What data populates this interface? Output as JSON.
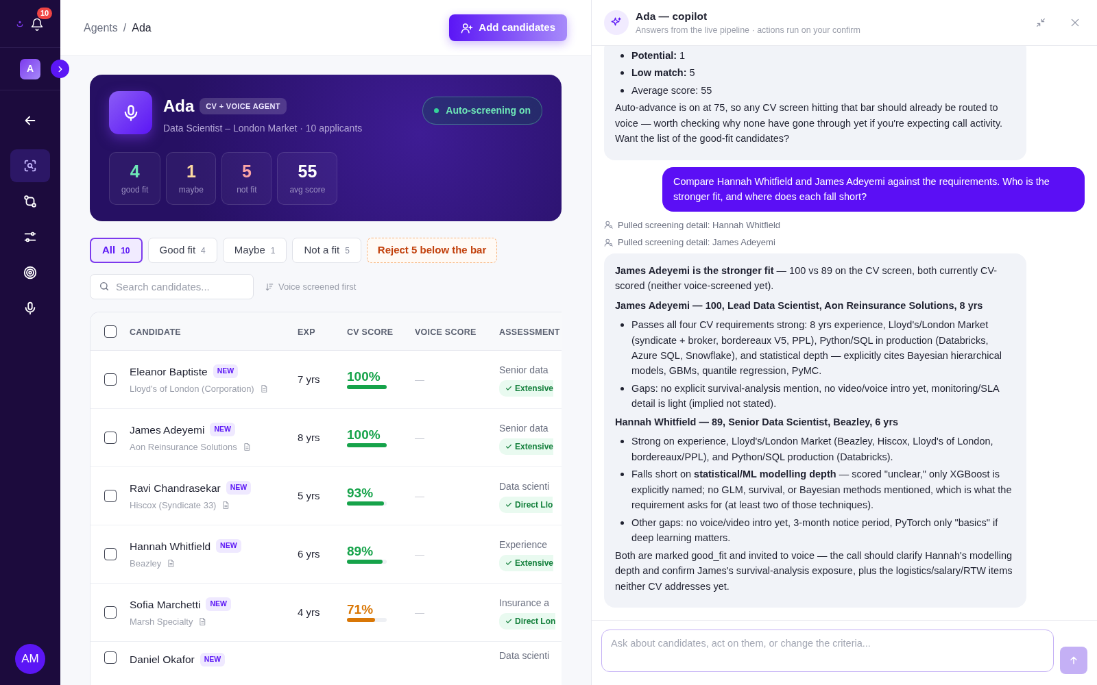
{
  "sidebar": {
    "notifications": "10",
    "workspace": "A",
    "nav": [
      {
        "kind": "back",
        "selected": false
      },
      {
        "kind": "scan",
        "selected": true
      },
      {
        "kind": "compare",
        "selected": false
      },
      {
        "kind": "sliders",
        "selected": false
      },
      {
        "kind": "target",
        "selected": false
      },
      {
        "kind": "mic",
        "selected": false
      }
    ],
    "user": "AM"
  },
  "header": {
    "breadcrumb": [
      "Agents",
      "Ada"
    ],
    "separator": "/",
    "action": "Add candidates"
  },
  "agent": {
    "name": "Ada",
    "badge": "CV + VOICE AGENT",
    "subtitle": "Data Scientist – London Market · 10 applicants",
    "auto_screening": {
      "label": "Auto-screening on",
      "on": true
    },
    "stats": [
      {
        "value": "4",
        "label": "good fit",
        "color": "#6ee7b7"
      },
      {
        "value": "1",
        "label": "maybe",
        "color": "#fcd9a0"
      },
      {
        "value": "5",
        "label": "not fit",
        "color": "#fca5a5"
      },
      {
        "value": "55",
        "label": "avg score",
        "color": "#ffffff"
      }
    ]
  },
  "filters": [
    {
      "label": "All",
      "count": "10",
      "selected": true
    },
    {
      "label": "Good fit",
      "count": "4",
      "selected": false
    },
    {
      "label": "Maybe",
      "count": "1",
      "selected": false
    },
    {
      "label": "Not a fit",
      "count": "5",
      "selected": false
    }
  ],
  "reject_action": "Reject 5 below the bar",
  "search": {
    "placeholder": "Search candidates..."
  },
  "sort": "Voice screened first",
  "table": {
    "columns": [
      "CANDIDATE",
      "EXP",
      "CV SCORE",
      "VOICE SCORE",
      "ASSESSMENT"
    ],
    "select_all": false,
    "rows": [
      {
        "name": "Eleanor Baptiste",
        "new": true,
        "badge": "NEW",
        "company": "Lloyd's of London (Corporation)",
        "exp": "7 yrs",
        "cv_score": "100%",
        "level": 1.0,
        "color": "#16a34a",
        "voice_score": "—",
        "assessment": "Senior data",
        "tag": "Extensive",
        "checked": false
      },
      {
        "name": "James Adeyemi",
        "new": true,
        "badge": "NEW",
        "company": "Aon Reinsurance Solutions",
        "exp": "8 yrs",
        "cv_score": "100%",
        "level": 1.0,
        "color": "#16a34a",
        "voice_score": "—",
        "assessment": "Senior data",
        "tag": "Extensive",
        "checked": false
      },
      {
        "name": "Ravi Chandrasekar",
        "new": true,
        "badge": "NEW",
        "company": "Hiscox (Syndicate 33)",
        "exp": "5 yrs",
        "cv_score": "93%",
        "level": 0.93,
        "color": "#16a34a",
        "voice_score": "—",
        "assessment": "Data scienti",
        "tag": "Direct Llo",
        "checked": false
      },
      {
        "name": "Hannah Whitfield",
        "new": true,
        "badge": "NEW",
        "company": "Beazley",
        "exp": "6 yrs",
        "cv_score": "89%",
        "level": 0.89,
        "color": "#16a34a",
        "voice_score": "—",
        "assessment": "Experience",
        "tag": "Extensive",
        "checked": false
      },
      {
        "name": "Sofia Marchetti",
        "new": true,
        "badge": "NEW",
        "company": "Marsh Specialty",
        "exp": "4 yrs",
        "cv_score": "71%",
        "level": 0.71,
        "color": "#d97706",
        "voice_score": "—",
        "assessment": "Insurance a",
        "tag": "Direct Lon",
        "checked": false
      },
      {
        "name": "Daniel Okafor",
        "new": true,
        "badge": "NEW",
        "assessment": "Data scienti",
        "checked": false
      }
    ]
  },
  "copilot": {
    "title": "Ada — copilot",
    "subtitle": "Answers from the live pipeline · actions run on your confirm",
    "messages": [
      {
        "kind": "assistant",
        "blocks": [
          {
            "kind": "list",
            "items": [
              "**Potential:** 1",
              "**Low match:** 5",
              "Average score: 55"
            ]
          },
          {
            "kind": "p",
            "text": "Auto-advance is on at 75, so any CV screen hitting that bar should already be routed to voice — worth checking why none have gone through yet if you're expecting call activity. Want the list of the good-fit candidates?"
          }
        ]
      },
      {
        "kind": "user",
        "text": "Compare Hannah Whitfield and James Adeyemi against the requirements. Who is the stronger fit, and where does each fall short?"
      },
      {
        "kind": "tool",
        "text": "Pulled screening detail: Hannah Whitfield"
      },
      {
        "kind": "tool",
        "text": "Pulled screening detail: James Adeyemi"
      },
      {
        "kind": "assistant",
        "blocks": [
          {
            "kind": "p",
            "text": "**James Adeyemi is the stronger fit** — 100 vs 89 on the CV screen, both currently CV-scored (neither voice-screened yet)."
          },
          {
            "kind": "heading",
            "text": "James Adeyemi — 100, Lead Data Scientist, Aon Reinsurance Solutions, 8 yrs"
          },
          {
            "kind": "list",
            "items": [
              "Passes all four CV requirements strong: 8 yrs experience, Lloyd's/London Market (syndicate + broker, bordereaux V5, PPL), Python/SQL in production (Databricks, Azure SQL, Snowflake), and statistical depth — explicitly cites Bayesian hierarchical models, GBMs, quantile regression, PyMC.",
              "Gaps: no explicit survival-analysis mention, no video/voice intro yet, monitoring/SLA detail is light (implied not stated)."
            ]
          },
          {
            "kind": "heading",
            "text": "Hannah Whitfield — 89, Senior Data Scientist, Beazley, 6 yrs"
          },
          {
            "kind": "list",
            "items": [
              "Strong on experience, Lloyd's/London Market (Beazley, Hiscox, Lloyd's of London, bordereaux/PPL), and Python/SQL production (Databricks).",
              "Falls short on **statistical/ML modelling depth** — scored \"unclear,\" only XGBoost is explicitly named; no GLM, survival, or Bayesian methods mentioned, which is what the requirement asks for (at least two of those techniques).",
              "Other gaps: no voice/video intro yet, 3-month notice period, PyTorch only \"basics\" if deep learning matters."
            ]
          },
          {
            "kind": "p",
            "text": "Both are marked good_fit and invited to voice — the call should clarify Hannah's modelling depth and confirm James's survival-analysis exposure, plus the logistics/salary/RTW items neither CV addresses yet."
          }
        ]
      }
    ],
    "input": {
      "placeholder": "Ask about candidates, act on them, or change the criteria..."
    }
  }
}
